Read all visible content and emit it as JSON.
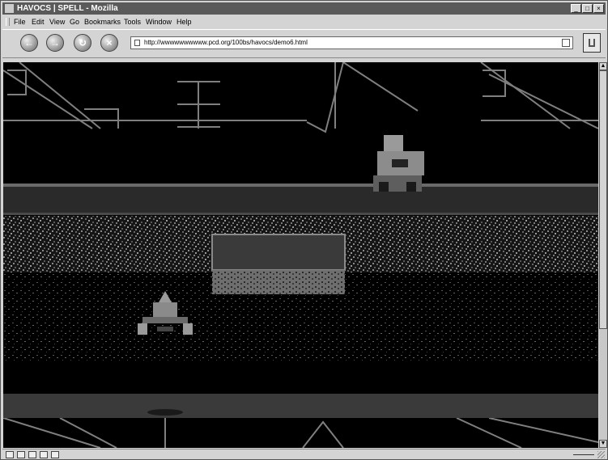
{
  "window": {
    "title": "HAVOCS | SPELL - Mozilla",
    "controls": {
      "minimize": "_",
      "maximize": "□",
      "close": "×"
    }
  },
  "menu": [
    "File",
    "Edit",
    "View",
    "Go",
    "Bookmarks",
    "Tools",
    "Window",
    "Help"
  ],
  "nav": {
    "buttons": [
      "back",
      "forward",
      "reload",
      "stop"
    ],
    "url": "http://wwwwwwwwww.pcd.org/100bs/havocs/demo6.html"
  },
  "game": {
    "icons": [
      "car-icon",
      "hovercraft-icon"
    ]
  }
}
